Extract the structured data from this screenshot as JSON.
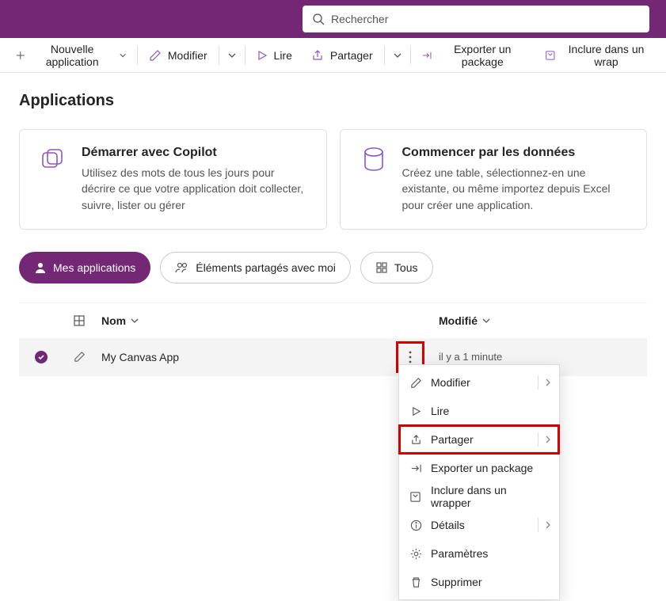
{
  "search": {
    "placeholder": "Rechercher"
  },
  "commands": {
    "new_app": "Nouvelle application",
    "edit": "Modifier",
    "play": "Lire",
    "share": "Partager",
    "export": "Exporter un package",
    "wrap": "Inclure dans un wrap"
  },
  "page_title": "Applications",
  "cards": {
    "copilot": {
      "title": "Démarrer avec Copilot",
      "desc": "Utilisez des mots de tous les jours pour décrire ce que votre application doit collecter, suivre, lister ou gérer"
    },
    "data": {
      "title": "Commencer par les données",
      "desc": "Créez une table, sélectionnez-en une existante, ou même importez depuis Excel pour créer une application."
    }
  },
  "filters": {
    "mine": "Mes applications",
    "shared": "Éléments partagés avec moi",
    "all": "Tous"
  },
  "columns": {
    "name": "Nom",
    "modified": "Modifié"
  },
  "rows": [
    {
      "name": "My Canvas App",
      "modified": "il y a 1 minute"
    }
  ],
  "menu": {
    "edit": "Modifier",
    "play": "Lire",
    "share": "Partager",
    "export": "Exporter un package",
    "wrap": "Inclure dans un wrapper",
    "details": "Détails",
    "settings": "Paramètres",
    "delete": "Supprimer"
  },
  "colors": {
    "brand": "#742774",
    "accent": "#8A2BE2",
    "highlight_box": "#d60000"
  }
}
